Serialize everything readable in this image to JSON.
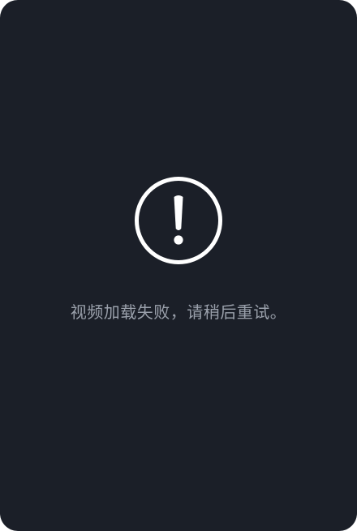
{
  "player": {
    "background_color": "#1b1f28",
    "error": {
      "icon": "exclamation-circle-icon",
      "icon_color": "#ffffff",
      "message": "视频加载失败，请稍后重试。",
      "message_color": "#9aa0ab"
    }
  }
}
